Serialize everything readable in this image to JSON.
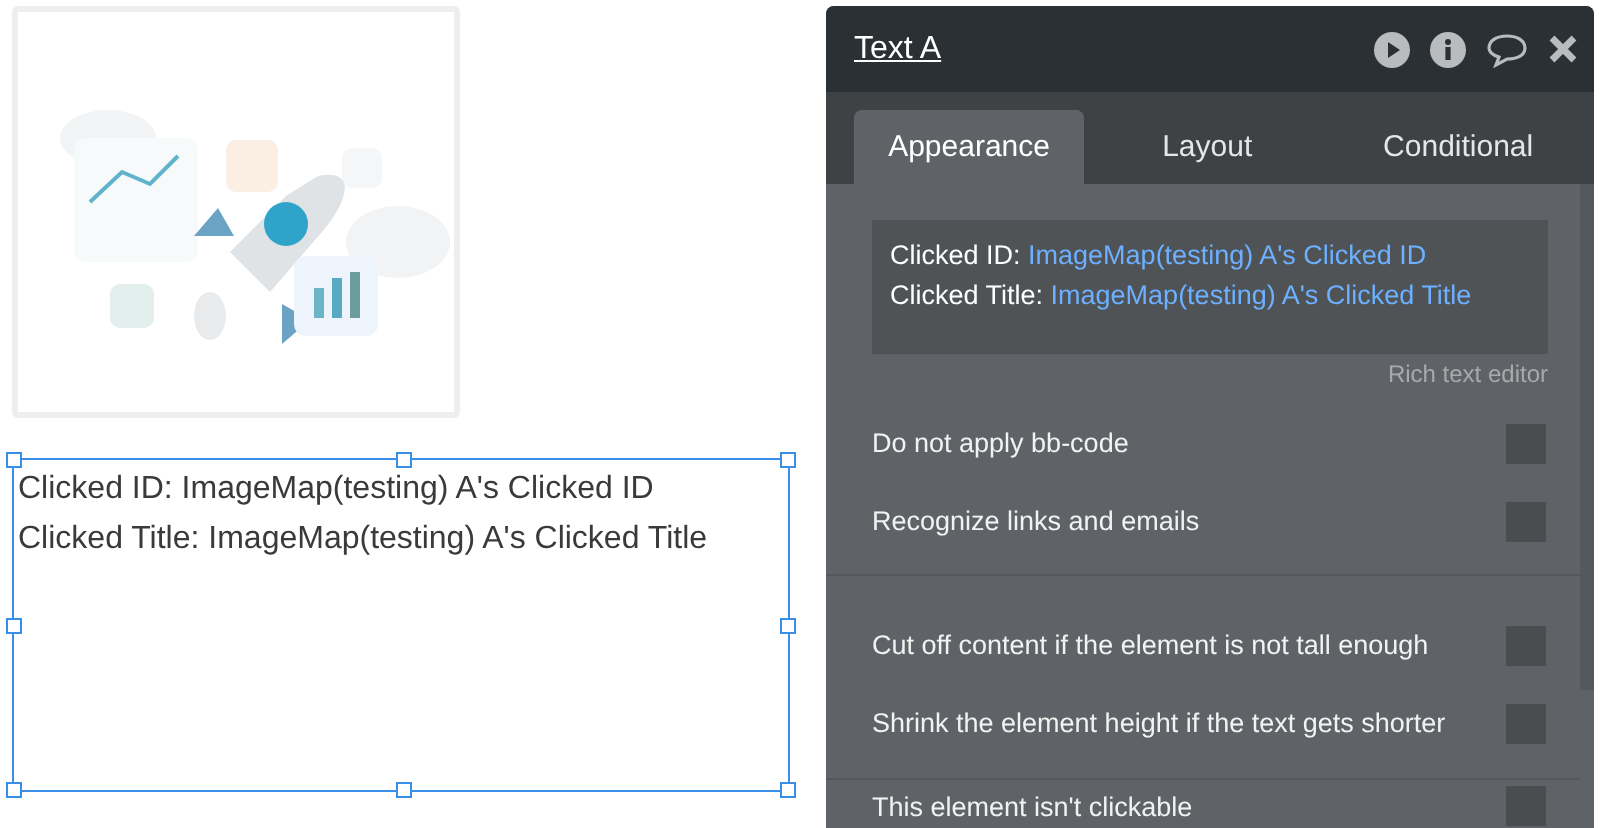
{
  "canvas": {
    "text_element": {
      "selected": true,
      "lines": [
        "Clicked ID: ImageMap(testing) A's Clicked ID",
        "Clicked Title: ImageMap(testing) A's Clicked Title"
      ]
    }
  },
  "panel": {
    "title": "Text A",
    "tabs": [
      {
        "label": "Appearance",
        "selected": true
      },
      {
        "label": "Layout",
        "selected": false
      },
      {
        "label": "Conditional",
        "selected": false
      }
    ],
    "rich_text": {
      "lines": [
        {
          "label": "Clicked ID:",
          "value": "ImageMap(testing) A's Clicked ID"
        },
        {
          "label": "Clicked Title:",
          "value": "ImageMap(testing) A's Clicked Title"
        }
      ],
      "caption": "Rich text editor"
    },
    "groups": [
      [
        {
          "label": "Do not apply bb-code",
          "checked": false
        },
        {
          "label": "Recognize links and emails",
          "checked": false
        }
      ],
      [
        {
          "label": "Cut off content if the element is not tall enough",
          "checked": false
        },
        {
          "label": "Shrink the element height if the text gets shorter",
          "checked": false
        }
      ],
      [
        {
          "label": "This element isn't clickable",
          "checked": false
        }
      ]
    ]
  }
}
